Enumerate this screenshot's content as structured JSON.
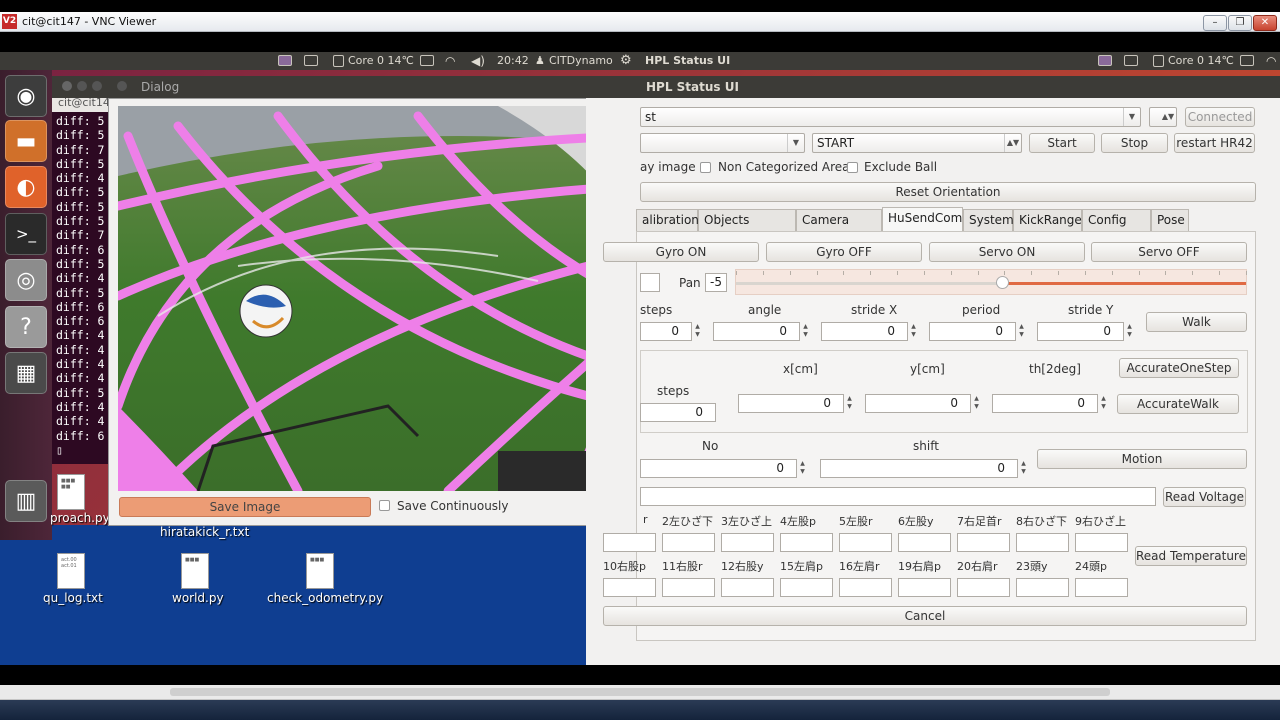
{
  "vnc": {
    "title": "cit@cit147 - VNC Viewer",
    "logo": "V2",
    "min": "–",
    "max": "❐",
    "close": "✕"
  },
  "left_panel": {
    "cpu": "Core 0 14℃",
    "time": "20:42",
    "user": "CITDynamo"
  },
  "right_panel": {
    "title": "HPL Status UI",
    "cpu": "Core 0 14℃"
  },
  "terminal": {
    "title": "cit@cit14",
    "lines": [
      "diff: 5",
      "diff: 5",
      "diff: 7",
      "diff: 5",
      "diff: 4",
      "diff: 5",
      "diff: 5",
      "diff: 5",
      "diff: 7",
      "diff: 6",
      "diff: 5",
      "diff: 4",
      "diff: 5",
      "diff: 6",
      "diff: 6",
      "diff: 4",
      "diff: 4",
      "diff: 4",
      "diff: 4",
      "diff: 5",
      "diff: 4",
      "diff: 4",
      "diff: 6"
    ]
  },
  "desktop": {
    "files": [
      "proach.py",
      "hiratakick_r.txt",
      "qu_log.txt",
      "world.py",
      "check_odometry.py"
    ]
  },
  "dialog": {
    "title": "Dialog",
    "save_image": "Save Image",
    "save_continuously": "Save Continuously"
  },
  "hpl": {
    "title": "HPL Status UI",
    "host_combo": "st",
    "connected": "Connected",
    "state_combo": "START",
    "start": "Start",
    "stop": "Stop",
    "restart": "restart HR42",
    "chk_display": "ay image",
    "chk_noncat": "Non Categorized Area",
    "chk_exclude": "Exclude Ball",
    "reset_orientation": "Reset Orientation",
    "tabs": [
      "alibration",
      "Objects Position",
      "Camera Setup",
      "HuSendCom",
      "System",
      "KickRange",
      "Config file",
      "Pose"
    ],
    "gyro_on": "Gyro ON",
    "gyro_off": "Gyro OFF",
    "servo_on": "Servo ON",
    "servo_off": "Servo OFF",
    "pan_label": "Pan",
    "pan_value": "-5",
    "pan_level": 0.52,
    "walk_labels": [
      "steps",
      "angle",
      "stride X",
      "period",
      "stride Y"
    ],
    "walk_values": [
      "0",
      "0",
      "0",
      "0",
      "0"
    ],
    "walk": "Walk",
    "acc_labels": [
      "x[cm]",
      "y[cm]",
      "th[2deg]"
    ],
    "acc_steps_label": "steps",
    "acc_steps_value": "0",
    "acc_values": [
      "0",
      "0",
      "0"
    ],
    "accurate_one_step": "AccurateOneStep",
    "accurate_walk": "AccurateWalk",
    "motion_labels": [
      "No",
      "shift"
    ],
    "motion_values": [
      "0",
      "0"
    ],
    "motion": "Motion",
    "read_voltage": "Read Voltage",
    "joint_row1": [
      "r",
      "2左ひざ下",
      "3左ひざ上",
      "4左股p",
      "5左股r",
      "6左股y",
      "7右足首r",
      "8右ひざ下",
      "9右ひざ上"
    ],
    "joint_row2": [
      "10右股p",
      "11右股r",
      "12右股y",
      "15左肩p",
      "16左肩r",
      "19右肩p",
      "20右肩r",
      "23頭y",
      "24頭p"
    ],
    "read_temperature": "Read Temperature",
    "cancel": "Cancel"
  }
}
